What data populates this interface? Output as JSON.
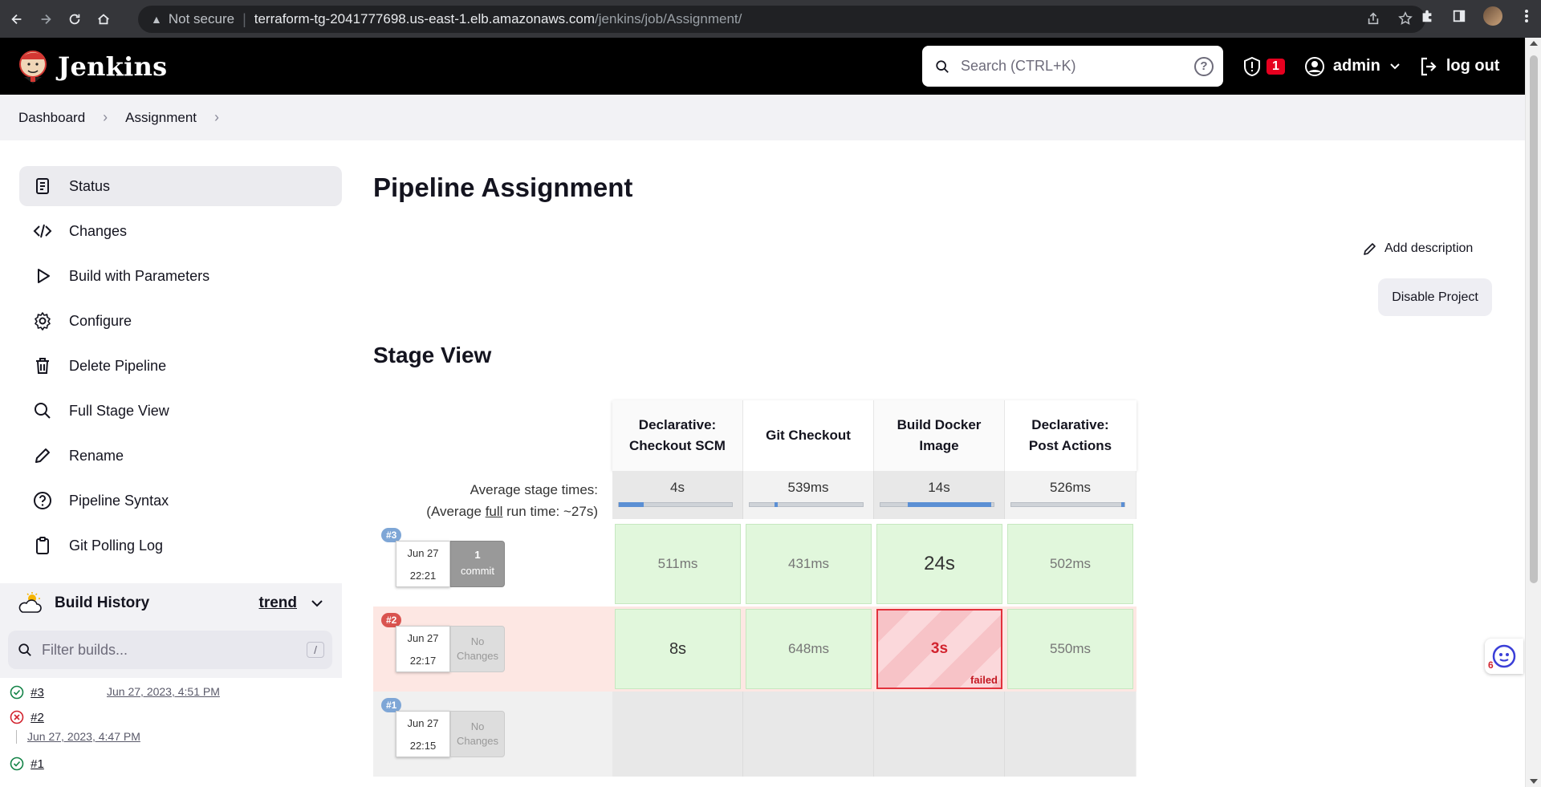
{
  "browser": {
    "security_label": "Not secure",
    "url_host": "terraform-tg-2041777698.us-east-1.elb.amazonaws.com",
    "url_path": "/jenkins/job/Assignment/"
  },
  "header": {
    "app_name": "Jenkins",
    "search_placeholder": "Search (CTRL+K)",
    "security_badge_count": "1",
    "username": "admin",
    "logout_label": "log out"
  },
  "breadcrumb": {
    "items": [
      "Dashboard",
      "Assignment"
    ]
  },
  "sidebar": {
    "items": [
      {
        "label": "Status",
        "icon": "status-icon",
        "active": true
      },
      {
        "label": "Changes",
        "icon": "code-icon"
      },
      {
        "label": "Build with Parameters",
        "icon": "play-icon"
      },
      {
        "label": "Configure",
        "icon": "gear-icon"
      },
      {
        "label": "Delete Pipeline",
        "icon": "trash-icon"
      },
      {
        "label": "Full Stage View",
        "icon": "search-icon"
      },
      {
        "label": "Rename",
        "icon": "pencil-icon"
      },
      {
        "label": "Pipeline Syntax",
        "icon": "help-icon"
      },
      {
        "label": "Git Polling Log",
        "icon": "clipboard-icon"
      }
    ]
  },
  "build_history": {
    "title": "Build History",
    "trend_label": "trend",
    "filter_placeholder": "Filter builds...",
    "filter_shortcut": "/",
    "builds": [
      {
        "number": "#3",
        "date": "Jun 27, 2023, 4:51 PM",
        "status": "success"
      },
      {
        "number": "#2",
        "date": "Jun 27, 2023, 4:47 PM",
        "status": "failed"
      },
      {
        "number": "#1",
        "date": "",
        "status": "success"
      }
    ]
  },
  "main": {
    "title": "Pipeline Assignment",
    "add_description": "Add description",
    "disable_project": "Disable Project",
    "stage_view_title": "Stage View"
  },
  "stage_view": {
    "stages": [
      "Declarative: Checkout SCM",
      "Git Checkout",
      "Build Docker Image",
      "Declarative: Post Actions"
    ],
    "avg_label": "Average stage times:",
    "avg_full_prefix": "(Average ",
    "avg_full_word": "full",
    "avg_full_suffix": " run time: ~27s)",
    "avg_times": [
      "4s",
      "539ms",
      "14s",
      "526ms"
    ],
    "avg_bar_fill": [
      0.22,
      0.02,
      0.74,
      0.02
    ],
    "avg_bar_offset": [
      0,
      0.22,
      0.24,
      0.98
    ],
    "runs": [
      {
        "tag": "#3",
        "date": "Jun 27",
        "time": "22:21",
        "changes_line1": "1",
        "changes_line2": "commit",
        "times": [
          "511ms",
          "431ms",
          "24s",
          "502ms"
        ],
        "status": [
          "success",
          "success",
          "success",
          "success"
        ]
      },
      {
        "tag": "#2",
        "date": "Jun 27",
        "time": "22:17",
        "changes_line1": "No",
        "changes_line2": "Changes",
        "times": [
          "8s",
          "648ms",
          "3s",
          "550ms"
        ],
        "status": [
          "success",
          "success",
          "failed",
          "success"
        ],
        "failed_label": "failed"
      },
      {
        "tag": "#1",
        "date": "Jun 27",
        "time": "22:15",
        "changes_line1": "No",
        "changes_line2": "Changes",
        "times": [],
        "status": []
      }
    ]
  },
  "colors": {
    "header_bg": "#000000",
    "success_cell": "#e1f7dc",
    "failed_border": "#e2323c",
    "badge_red": "#e6001f",
    "run_tag_blue": "#7ea6d6",
    "run_tag_red": "#d9534f"
  },
  "chat_widget_count": "6"
}
